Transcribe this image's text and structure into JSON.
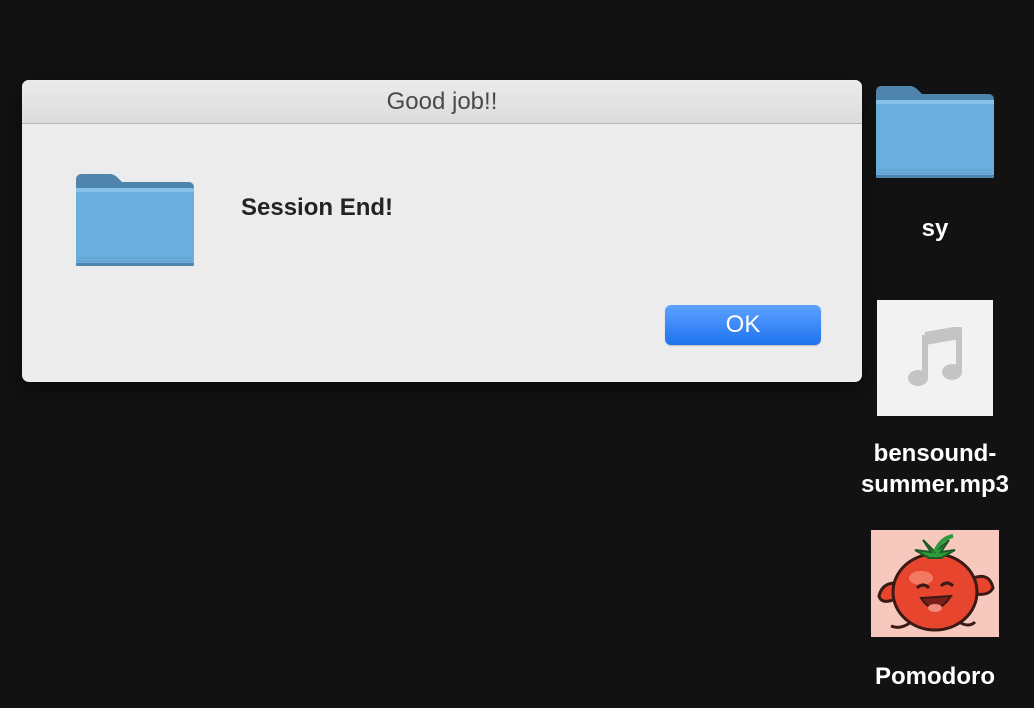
{
  "dialog": {
    "title": "Good job!!",
    "message": "Session End!",
    "icon": "folder-icon",
    "ok_label": "OK"
  },
  "desktop": {
    "items": [
      {
        "label": "sy",
        "icon": "folder-icon"
      },
      {
        "label_line1": "bensound-",
        "label_line2": "summer.mp3",
        "icon": "audio-file-icon"
      },
      {
        "label": "Pomodoro",
        "icon": "tomato-icon"
      }
    ]
  },
  "colors": {
    "desktop_bg": "#121212",
    "dialog_bg": "#ececec",
    "accent": "#2a7bf2",
    "folder": "#6aaede"
  }
}
